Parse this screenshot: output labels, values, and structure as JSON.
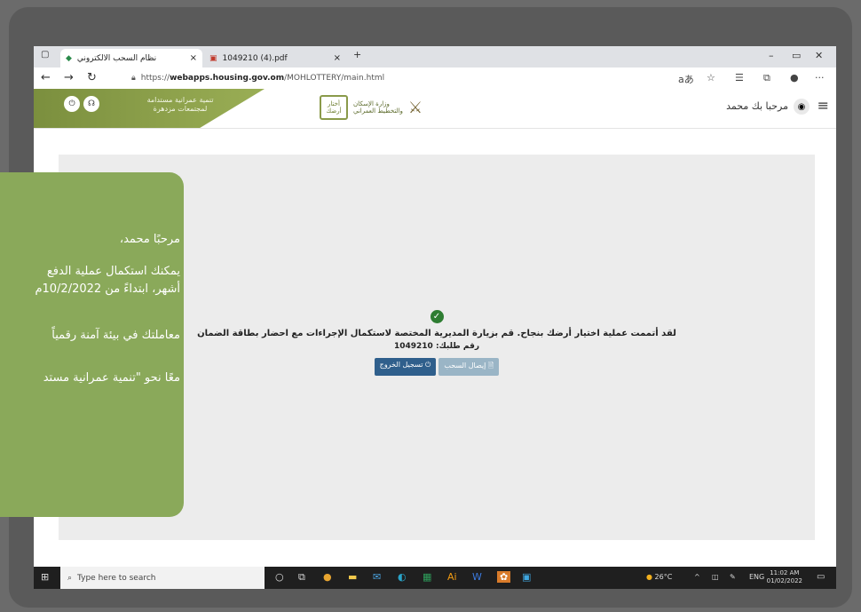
{
  "browser": {
    "tabs": [
      {
        "label": "نظام السحب الالكتروني",
        "close": "×"
      },
      {
        "label": "1049210 (4).pdf",
        "close": "×"
      }
    ],
    "new_tab": "+",
    "url_prefix": "https://",
    "url_domain": "webapps.housing.gov.om",
    "url_path": "/MOHLOTTERY/main.html"
  },
  "site": {
    "slogan_line1": "تنمية عمرانية مستدامة",
    "slogan_line2": "لمجتمعات مزدهرة",
    "logo_text": "أختار أرضك",
    "ministry_line1": "وزارة الإسكان",
    "ministry_line2": "والتخطيط العمراني",
    "welcome": "مرحبا بك محمد"
  },
  "result": {
    "message": "لقد أتممت عملية اختيار أرضك بنجاح. قم بزيارة المديرية المختصة لاستكمال الإجراءات مع احضار بطاقة الضمان",
    "request_label": "رقم طلبك:",
    "request_number": "1049210",
    "receipt_button": "إيصال السحب",
    "logout_button": "تسجيل الخروج"
  },
  "taskbar": {
    "search_placeholder": "Type here to search",
    "temperature": "26°C",
    "lang": "ENG",
    "time": "11:02 AM",
    "date": "01/02/2022"
  },
  "overlay": {
    "greeting": "مرحبًا محمد،",
    "line1": "يمكنك استكمال عملية الدفع",
    "line2": "أشهر، ابتداءً من 10/2/2022م",
    "line3": "معاملتك في بيئة آمنة رقمياً",
    "line4": "معًا نحو \"تنمية عمرانية مستد"
  }
}
